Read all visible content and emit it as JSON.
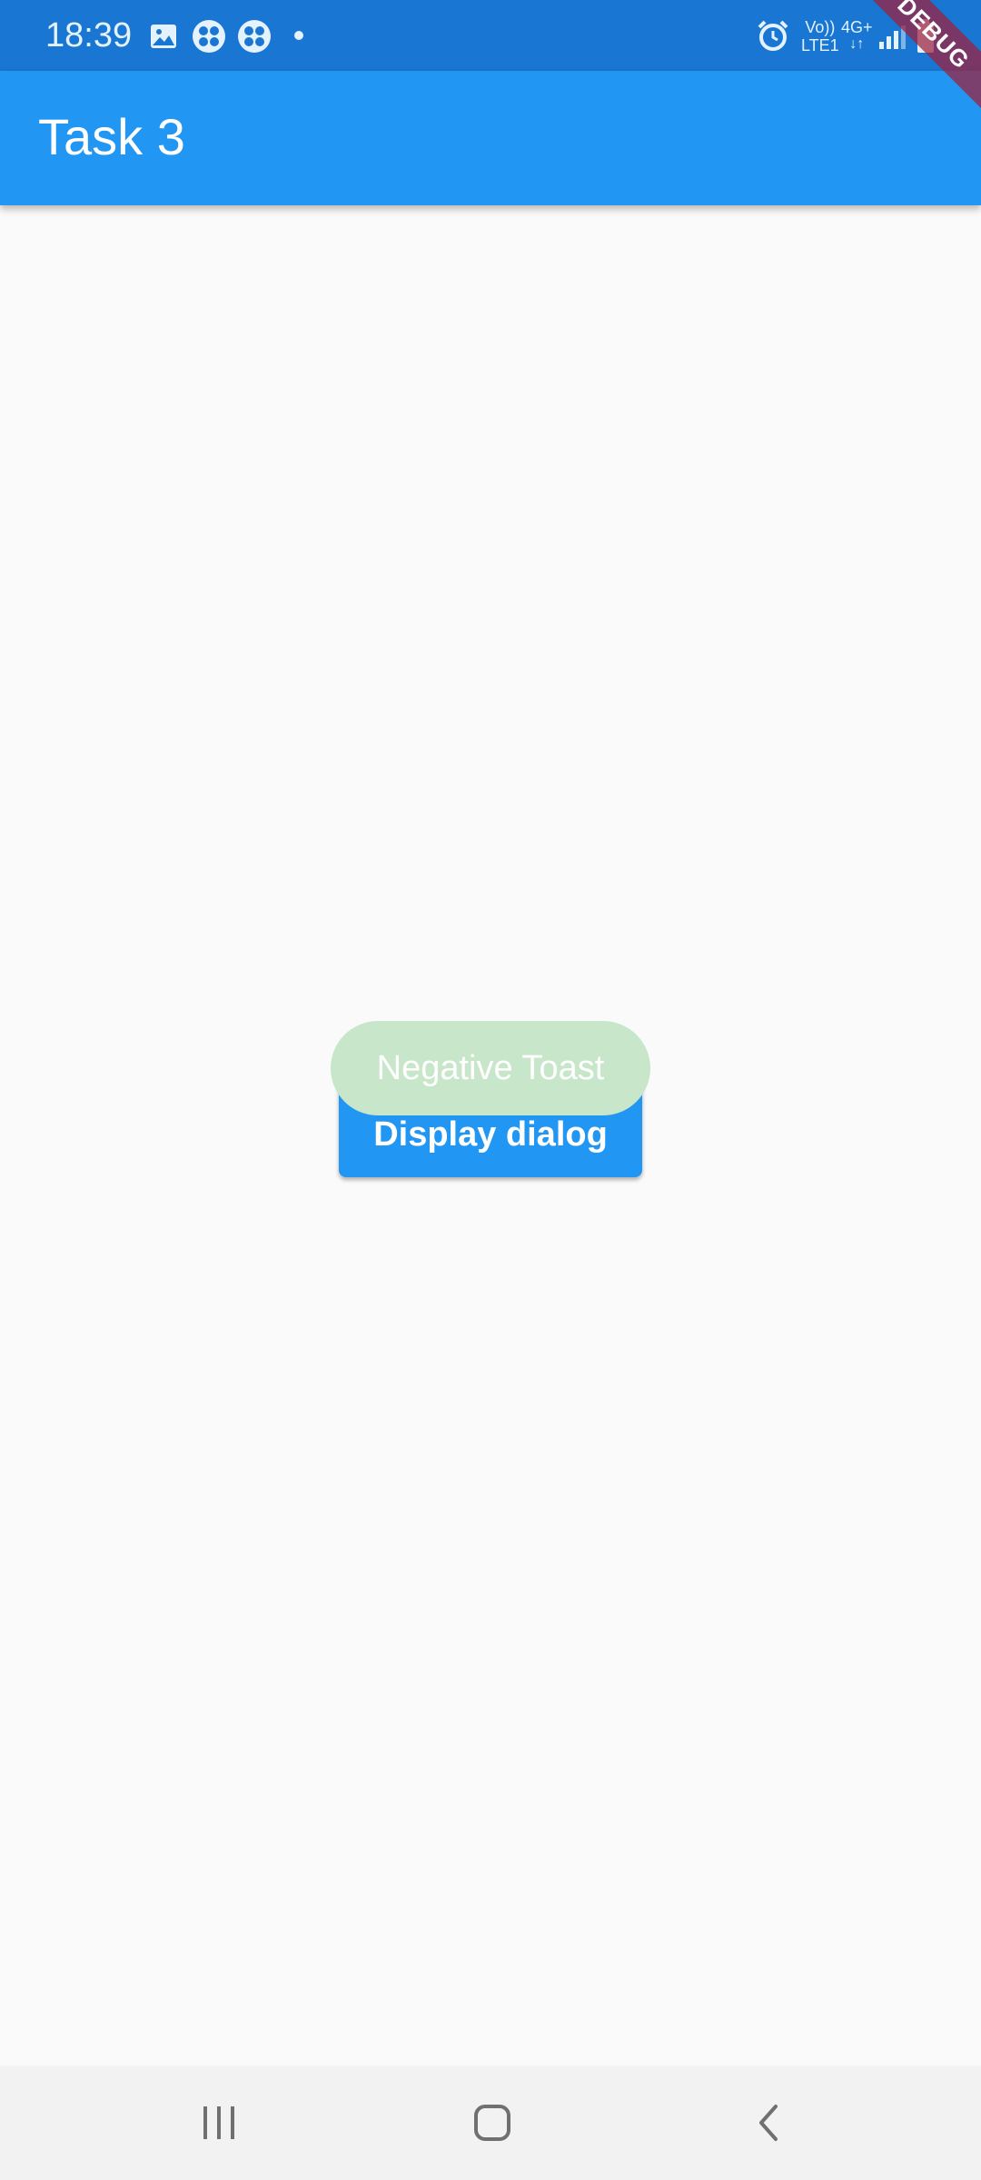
{
  "status_bar": {
    "time": "18:39",
    "network_top": "Vo))",
    "network_bottom": "LTE1",
    "network_type": "4G+",
    "icons": [
      "image-icon",
      "app-icon",
      "app-icon",
      "dot-icon",
      "alarm-icon",
      "signal-icon",
      "battery-icon"
    ]
  },
  "app_bar": {
    "title": "Task 3"
  },
  "debug_banner": {
    "label": "DEBUG"
  },
  "main": {
    "button_label": "Display dialog"
  },
  "toast": {
    "message": "Negative Toast"
  },
  "nav_bar": {
    "buttons": [
      "recent-apps",
      "home",
      "back"
    ]
  },
  "colors": {
    "status_bar": "#1976D2",
    "app_bar": "#2196F3",
    "button": "#2196F3",
    "toast_background": "#C8E6C9",
    "background": "#FAFAFA",
    "nav_bar": "#F2F2F2"
  }
}
